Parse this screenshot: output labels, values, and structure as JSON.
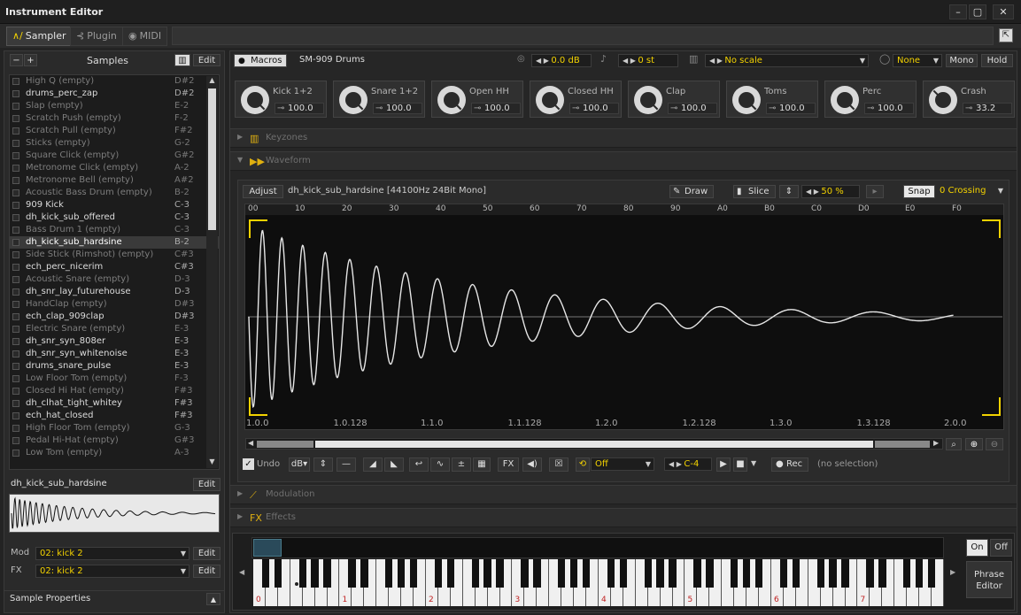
{
  "window": {
    "title": "Instrument Editor",
    "minimize": "–",
    "maximize": "▢",
    "close": "✕"
  },
  "tabs": [
    {
      "label": "Sampler",
      "icon": "∧/"
    },
    {
      "label": "Plugin",
      "icon": "⊰"
    },
    {
      "label": "MIDI",
      "icon": "◉"
    }
  ],
  "samples_panel": {
    "title": "Samples",
    "minus": "−",
    "plus": "+",
    "edit": "Edit",
    "items": [
      {
        "name": "High Q (empty)",
        "note": "D#2",
        "empty": true
      },
      {
        "name": "drums_perc_zap",
        "note": "D#2",
        "empty": false
      },
      {
        "name": "Slap (empty)",
        "note": "E-2",
        "empty": true
      },
      {
        "name": "Scratch Push (empty)",
        "note": "F-2",
        "empty": true
      },
      {
        "name": "Scratch Pull (empty)",
        "note": "F#2",
        "empty": true
      },
      {
        "name": "Sticks (empty)",
        "note": "G-2",
        "empty": true
      },
      {
        "name": "Square Click (empty)",
        "note": "G#2",
        "empty": true
      },
      {
        "name": "Metronome Click (empty)",
        "note": "A-2",
        "empty": true
      },
      {
        "name": "Metronome Bell (empty)",
        "note": "A#2",
        "empty": true
      },
      {
        "name": "Acoustic Bass Drum (empty)",
        "note": "B-2",
        "empty": true
      },
      {
        "name": "909 Kick",
        "note": "C-3",
        "empty": false
      },
      {
        "name": "dh_kick_sub_offered",
        "note": "C-3",
        "empty": false
      },
      {
        "name": "Bass Drum 1 (empty)",
        "note": "C-3",
        "empty": true
      },
      {
        "name": "dh_kick_sub_hardsine",
        "note": "B-2",
        "empty": false,
        "selected": true
      },
      {
        "name": "Side Stick (Rimshot) (empty)",
        "note": "C#3",
        "empty": true
      },
      {
        "name": "ech_perc_nicerim",
        "note": "C#3",
        "empty": false
      },
      {
        "name": "Acoustic Snare (empty)",
        "note": "D-3",
        "empty": true
      },
      {
        "name": "dh_snr_lay_futurehouse",
        "note": "D-3",
        "empty": false
      },
      {
        "name": "HandClap (empty)",
        "note": "D#3",
        "empty": true
      },
      {
        "name": "ech_clap_909clap",
        "note": "D#3",
        "empty": false
      },
      {
        "name": "Electric Snare (empty)",
        "note": "E-3",
        "empty": true
      },
      {
        "name": "dh_snr_syn_808er",
        "note": "E-3",
        "empty": false
      },
      {
        "name": "dh_snr_syn_whitenoise",
        "note": "E-3",
        "empty": false
      },
      {
        "name": "drums_snare_pulse",
        "note": "E-3",
        "empty": false
      },
      {
        "name": "Low Floor Tom (empty)",
        "note": "F-3",
        "empty": true
      },
      {
        "name": "Closed Hi Hat (empty)",
        "note": "F#3",
        "empty": true
      },
      {
        "name": "dh_clhat_tight_whitey",
        "note": "F#3",
        "empty": false
      },
      {
        "name": "ech_hat_closed",
        "note": "F#3",
        "empty": false
      },
      {
        "name": "High Floor Tom (empty)",
        "note": "G-3",
        "empty": true
      },
      {
        "name": "Pedal Hi-Hat (empty)",
        "note": "G#3",
        "empty": true
      },
      {
        "name": "Low Tom (empty)",
        "note": "A-3",
        "empty": true
      }
    ],
    "selected_name": "dh_kick_sub_hardsine",
    "selected_edit": "Edit",
    "mod_label": "Mod",
    "mod_value": "02: kick 2",
    "mod_edit": "Edit",
    "fx_label": "FX",
    "fx_value": "02: kick 2",
    "fx_edit": "Edit",
    "sample_properties": "Sample Properties"
  },
  "top_bar": {
    "macros": "Macros",
    "instrument_name": "SM-909 Drums",
    "volume": "0.0 dB",
    "transpose": "0 st",
    "scale": "No scale",
    "quantize": "None",
    "mono": "Mono",
    "hold": "Hold"
  },
  "macros": [
    {
      "name": "Kick 1+2",
      "value": "100.0",
      "level": 1.0
    },
    {
      "name": "Snare 1+2",
      "value": "100.0",
      "level": 1.0
    },
    {
      "name": "Open HH",
      "value": "100.0",
      "level": 1.0
    },
    {
      "name": "Closed HH",
      "value": "100.0",
      "level": 1.0
    },
    {
      "name": "Clap",
      "value": "100.0",
      "level": 1.0
    },
    {
      "name": "Toms",
      "value": "100.0",
      "level": 1.0
    },
    {
      "name": "Perc",
      "value": "100.0",
      "level": 1.0
    },
    {
      "name": "Crash",
      "value": "33.2",
      "level": 0.332
    }
  ],
  "sections": {
    "keyzones": "Keyzones",
    "waveform": "Waveform",
    "modulation": "Modulation",
    "effects": "Effects"
  },
  "waveform": {
    "adjust": "Adjust",
    "info": "dh_kick_sub_hardsine [44100Hz 24Bit Mono]",
    "draw": "Draw",
    "slice": "Slice",
    "zoom": "50 %",
    "snap": "Snap",
    "snap_mode": "0 Crossing",
    "top_ticks": [
      "00",
      "10",
      "20",
      "30",
      "40",
      "50",
      "60",
      "70",
      "80",
      "90",
      "A0",
      "B0",
      "C0",
      "D0",
      "E0",
      "F0"
    ],
    "bottom_ticks": [
      "1.0.0",
      "1.0.128",
      "1.1.0",
      "1.1.128",
      "1.2.0",
      "1.2.128",
      "1.3.0",
      "1.3.128",
      "2.0.0"
    ]
  },
  "wave_toolbar": {
    "undo": "Undo",
    "db": "dB",
    "fx": "FX",
    "loop_mode": "Off",
    "note": "C-4",
    "rec": "Rec",
    "selection": "(no selection)"
  },
  "keyboard": {
    "on": "On",
    "off": "Off",
    "phrase": "Phrase Editor",
    "octaves": [
      "0",
      "1",
      "2",
      "3",
      "4",
      "5",
      "6",
      "7"
    ]
  }
}
